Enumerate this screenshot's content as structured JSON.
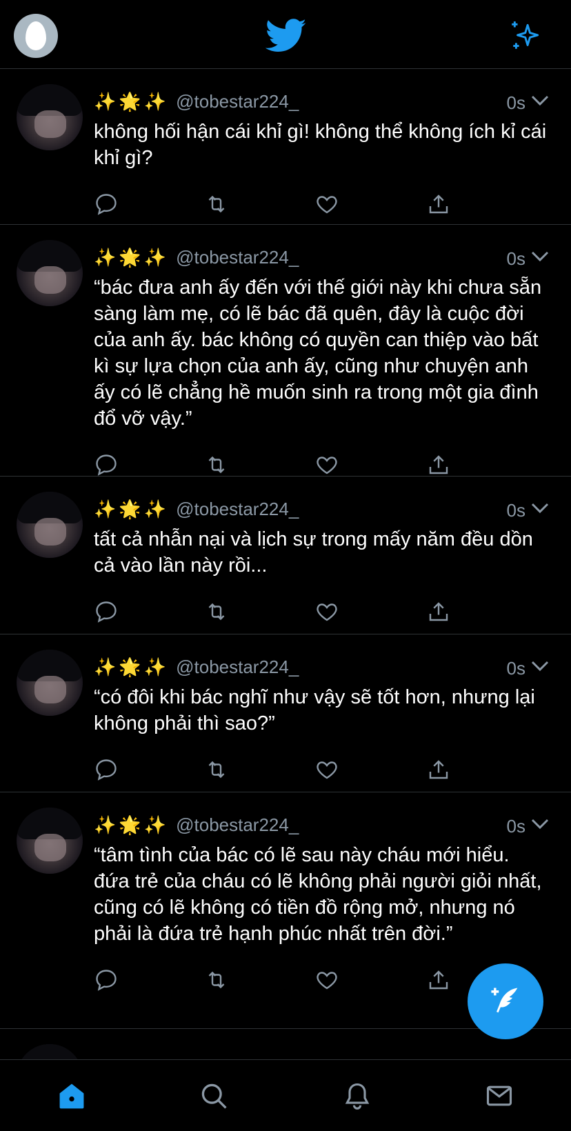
{
  "header": {
    "profile_icon": "egg-avatar-icon",
    "logo_icon": "twitter-bird-icon",
    "sparkle_icon": "sparkle-icon"
  },
  "colors": {
    "accent": "#1d9bf0",
    "secondary_text": "#8b98a5",
    "background": "#000000",
    "divider": "#2f3336"
  },
  "tweets": [
    {
      "emojis": "✨🌟✨",
      "handle": "@tobestar224_",
      "time": "0s",
      "text": "không hối hận cái khỉ gì! không thể không ích kỉ cái khỉ gì?"
    },
    {
      "emojis": "✨🌟✨",
      "handle": "@tobestar224_",
      "time": "0s",
      "text": "“bác đưa anh ấy đến với thế giới này khi chưa sẵn sàng làm mẹ, có lẽ bác đã quên, đây là cuộc đời của anh ấy. bác không có quyền can thiệp vào bất kì sự lựa chọn của anh ấy, cũng như chuyện anh ấy có lẽ chẳng hề muốn sinh ra trong một gia đình đổ vỡ vậy.”"
    },
    {
      "emojis": "✨🌟✨",
      "handle": "@tobestar224_",
      "time": "0s",
      "text": "tất cả nhẫn nại và lịch sự trong mấy năm đều dồn cả vào lần này rồi..."
    },
    {
      "emojis": "✨🌟✨",
      "handle": "@tobestar224_",
      "time": "0s",
      "text": "“có đôi khi bác nghĩ như vậy sẽ tốt hơn, nhưng lại không phải thì sao?”"
    },
    {
      "emojis": "✨🌟✨",
      "handle": "@tobestar224_",
      "time": "0s",
      "text": "“tâm tình của bác có lẽ sau này cháu mới hiểu. đứa trẻ của cháu có lẽ không phải người giỏi nhất, cũng có lẽ không có tiền đồ rộng mở, nhưng nó phải là đứa trẻ hạnh phúc nhất trên đời.”"
    }
  ],
  "tabbar": {
    "items": [
      "home-icon",
      "search-icon",
      "notifications-icon",
      "messages-icon"
    ]
  }
}
